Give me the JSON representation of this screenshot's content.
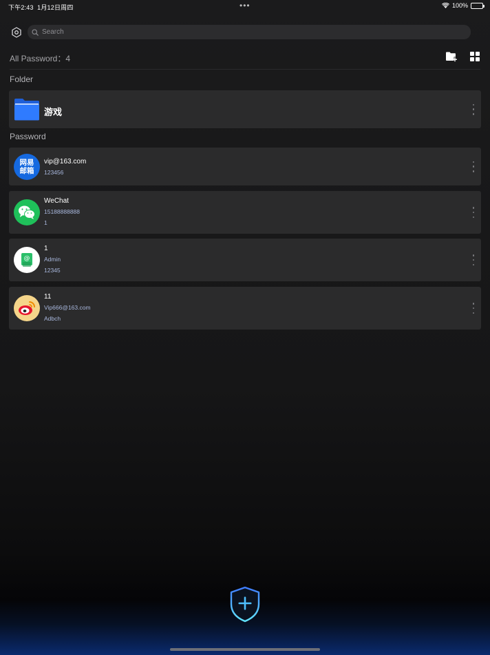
{
  "status_bar": {
    "time": "下午2:43",
    "date": "1月12日周四",
    "dots": "•••",
    "battery": "100%"
  },
  "search": {
    "placeholder": "Search"
  },
  "summary": {
    "all_label": "All Password：4"
  },
  "sections": {
    "folder": "Folder",
    "password": "Password"
  },
  "folders": [
    {
      "name": "游戏",
      "icon": "folder-icon"
    }
  ],
  "passwords": [
    {
      "icon": "netease-mail-icon",
      "avatar_text_1": "网易",
      "avatar_text_2": "邮箱",
      "title": "vip@163.com",
      "line1": "123456",
      "line2": ""
    },
    {
      "icon": "wechat-icon",
      "title": "WeChat",
      "line1": "15188888888",
      "line2": "1"
    },
    {
      "icon": "email-app-icon",
      "title": "1",
      "line1": "Admin",
      "line2": "12345"
    },
    {
      "icon": "weibo-icon",
      "title": "11",
      "line1": "Vip666@163.com",
      "line2": "Adbch"
    }
  ],
  "colors": {
    "background": "#161617",
    "card": "#2b2b2c",
    "accent": "#1569e0",
    "secondary_text": "#a9b8de",
    "add_button": "#2f8fd8"
  }
}
